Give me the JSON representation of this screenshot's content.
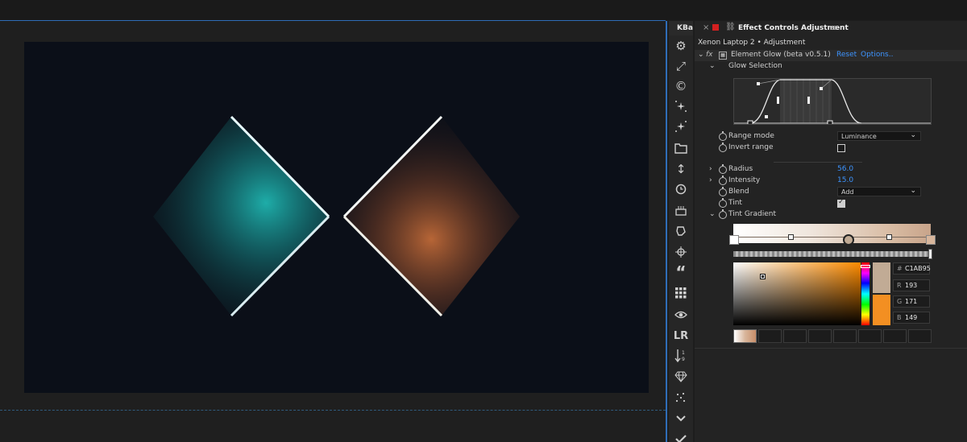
{
  "app": {
    "toolbar_tab": "KBar",
    "panel_title": "Effect Controls Adjustment",
    "clip_name": "Xenon Laptop 2 • Adjustment"
  },
  "effect": {
    "fx_label": "fx",
    "name": "Element Glow (beta v0.5.1)",
    "reset": "Reset",
    "options": "Options..",
    "glow_selection_label": "Glow Selection"
  },
  "params": {
    "range_mode": {
      "label": "Range mode",
      "value": "Luminance"
    },
    "invert_range": {
      "label": "Invert range",
      "checked": false
    },
    "radius": {
      "label": "Radius",
      "value": "56.0"
    },
    "intensity": {
      "label": "Intensity",
      "value": "15.0"
    },
    "blend": {
      "label": "Blend",
      "value": "Add"
    },
    "tint": {
      "label": "Tint",
      "checked": true
    },
    "tint_gradient": {
      "label": "Tint Gradient"
    }
  },
  "color_picker": {
    "hex_prefix": "#",
    "hex": "C1AB95",
    "r_label": "R",
    "r": "193",
    "g_label": "G",
    "g": "171",
    "b_label": "B",
    "b": "149",
    "current_color": "#c1ab95",
    "original_color": "#f38f22"
  },
  "toolbar_icons": [
    "gear-icon",
    "expand-icon",
    "copyright-icon",
    "spark-icon",
    "spark-alt-icon",
    "folder-icon",
    "vertical-arrows-icon",
    "clock-icon",
    "cake-icon",
    "shape-icon",
    "crosshair-icon",
    "quote-icon",
    "grid-icon",
    "eye-icon",
    "lr-icon",
    "sort-icon",
    "diamond-icon",
    "dots-icon",
    "chevron-down-icon",
    "checkmark-icon"
  ],
  "toolbar_text": {
    "lr": "LR",
    "quote": "“",
    "sort_digits": "1 9"
  },
  "colors": {
    "accent_blue": "#3d94ff",
    "panel_bg": "#232323",
    "glow_teal": "#1fb5b0",
    "glow_orange": "#c06a38"
  }
}
